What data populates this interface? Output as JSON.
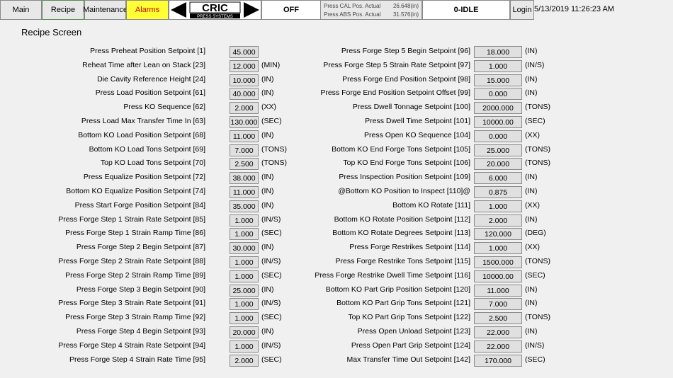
{
  "nav": {
    "main": "Main",
    "recipe": "Recipe",
    "maintenance": "Maintenance",
    "alarms": "Alarms",
    "login": "Login"
  },
  "logo": {
    "brand": "CRIC",
    "sub": "PRESS SYSTEMS"
  },
  "status": {
    "mode": "OFF",
    "state": "0-IDLE"
  },
  "positions": {
    "cal_label": "Press CAL Pos. Actual",
    "cal_value": "26.648(in)",
    "abs_label": "Press ABS Pos. Actual",
    "abs_value": "31.576(in)"
  },
  "datetime": "5/13/2019 11:26:23 AM",
  "page_title": "Recipe Screen",
  "left_setpoints": [
    {
      "label": "Press Preheat Position Setpoint [1]",
      "value": "45.000",
      "unit": ""
    },
    {
      "label": "Reheat Time after Lean on Stack [23]",
      "value": "12.000",
      "unit": "(MIN)"
    },
    {
      "label": "Die Cavity Reference Height [24]",
      "value": "10.000",
      "unit": "(IN)"
    },
    {
      "label": "Press Load Position Setpoint [61]",
      "value": "40.000",
      "unit": "(IN)"
    },
    {
      "label": "Press KO Sequence [62]",
      "value": "2.000",
      "unit": "(XX)"
    },
    {
      "label": "Press Load Max Transfer Time In [63]",
      "value": "130.000",
      "unit": "(SEC)"
    },
    {
      "label": "Bottom KO Load Position Setpoint [68]",
      "value": "11.000",
      "unit": "(IN)"
    },
    {
      "label": "Bottom KO Load Tons Setpoint [69]",
      "value": "7.000",
      "unit": "(TONS)"
    },
    {
      "label": "Top KO Load Tons Setpoint [70]",
      "value": "2.500",
      "unit": "(TONS)"
    },
    {
      "label": "Press Equalize Position Setpoint [72]",
      "value": "38.000",
      "unit": "(IN)"
    },
    {
      "label": "Bottom KO Equalize Position Setpoint [74]",
      "value": "11.000",
      "unit": "(IN)"
    },
    {
      "label": "Press Start Forge Position Setpoint [84]",
      "value": "35.000",
      "unit": "(IN)"
    },
    {
      "label": "Press Forge Step 1 Strain Rate Setpoint [85]",
      "value": "1.000",
      "unit": "(IN/S)"
    },
    {
      "label": "Press Forge Step 1 Strain Ramp Time [86]",
      "value": "1.000",
      "unit": "(SEC)"
    },
    {
      "label": "Press Forge Step 2 Begin Setpoint [87]",
      "value": "30.000",
      "unit": "(IN)"
    },
    {
      "label": "Press Forge Step 2 Strain Rate Setpoint [88]",
      "value": "1.000",
      "unit": "(IN/S)"
    },
    {
      "label": "Press Forge Step 2 Strain Ramp Time [89]",
      "value": "1.000",
      "unit": "(SEC)"
    },
    {
      "label": "Press Forge Step 3 Begin Setpoint [90]",
      "value": "25.000",
      "unit": "(IN)"
    },
    {
      "label": "Press Forge Step 3 Strain Rate Setpoint [91]",
      "value": "1.000",
      "unit": "(IN/S)"
    },
    {
      "label": "Press Forge Step 3 Strain Ramp Time [92]",
      "value": "1.000",
      "unit": "(SEC)"
    },
    {
      "label": "Press Forge Step 4 Begin Setpoint [93]",
      "value": "20.000",
      "unit": "(IN)"
    },
    {
      "label": "Press Forge Step 4 Strain Rate Setpoint [94]",
      "value": "1.000",
      "unit": "(IN/S)"
    },
    {
      "label": "Press Forge Step 4 Strain Rate Time [95]",
      "value": "2.000",
      "unit": "(SEC)"
    }
  ],
  "right_setpoints": [
    {
      "label": "Press Forge Step 5 Begin Setpoint [96]",
      "value": "18.000",
      "unit": "(IN)"
    },
    {
      "label": "Press Forge Step 5 Strain Rate Setpoint [97]",
      "value": "1.000",
      "unit": "(IN/S)"
    },
    {
      "label": "Press Forge End Position Setpoint [98]",
      "value": "15.000",
      "unit": "(IN)"
    },
    {
      "label": "Press Forge End Position Setpoint Offset [99]",
      "value": "0.000",
      "unit": "(IN)"
    },
    {
      "label": "Press Dwell Tonnage Setpoint [100]",
      "value": "2000.000",
      "unit": "(TONS)"
    },
    {
      "label": "Press Dwell Time Setpoint [101]",
      "value": "10000.00",
      "unit": "(SEC)"
    },
    {
      "label": "Press Open KO Sequence [104]",
      "value": "0.000",
      "unit": "(XX)"
    },
    {
      "label": "Bottom KO End Forge Tons Setpoint [105]",
      "value": "25.000",
      "unit": "(TONS)"
    },
    {
      "label": "Top KO End Forge Tons Setpoint [106]",
      "value": "20.000",
      "unit": "(TONS)"
    },
    {
      "label": "Press Inspection Position Setpoint [109]",
      "value": "6.000",
      "unit": "(IN)"
    },
    {
      "label": "@Bottom KO Position to Inspect  [110]@",
      "value": "0.875",
      "unit": "(IN)"
    },
    {
      "label": "Bottom KO Rotate [111]",
      "value": "1.000",
      "unit": "(XX)"
    },
    {
      "label": "Bottom KO Rotate Position Setpoint [112]",
      "value": "2.000",
      "unit": "(IN)"
    },
    {
      "label": "Bottom KO Rotate Degrees Setpoint [113]",
      "value": "120.000",
      "unit": "(DEG)"
    },
    {
      "label": "Press Forge Restrikes Setpoint [114]",
      "value": "1.000",
      "unit": "(XX)"
    },
    {
      "label": "Press Forge Restrike Tons Setpoint [115]",
      "value": "1500.000",
      "unit": "(TONS)"
    },
    {
      "label": "Press Forge Restrike Dwell Time Setpoint [116]",
      "value": "10000.00",
      "unit": "(SEC)"
    },
    {
      "label": "Bottom KO Part Grip Position Setpoint [120]",
      "value": "11.000",
      "unit": "(IN)"
    },
    {
      "label": "Bottom KO Part Grip Tons Setpoint [121]",
      "value": "7.000",
      "unit": "(IN)"
    },
    {
      "label": "Top KO Part Grip Tons Setpoint [122]",
      "value": "2.500",
      "unit": "(TONS)"
    },
    {
      "label": "Press Open Unload Setpoint [123]",
      "value": "22.000",
      "unit": "(IN)"
    },
    {
      "label": "Press Open Part Grip Setpoint [124]",
      "value": "22.000",
      "unit": "(IN/S)"
    },
    {
      "label": "Max Transfer Time Out Setpoint [142]",
      "value": "170.000",
      "unit": "(SEC)"
    }
  ]
}
